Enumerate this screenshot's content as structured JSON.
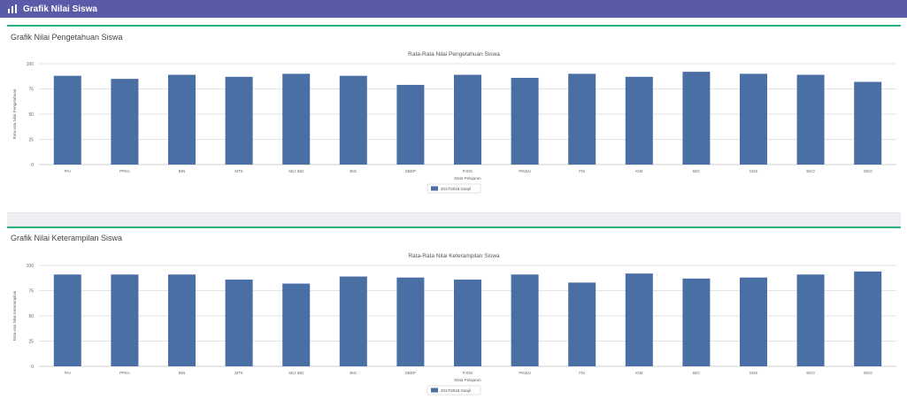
{
  "header": {
    "title": "Grafik Nilai Siswa",
    "icon": "chart-icon",
    "color": "#5a5ba8"
  },
  "colors": {
    "accent": "#2ab27b",
    "bar": "#4a6fa5"
  },
  "panels": [
    {
      "title": "Grafik Nilai Pengetahuan Siswa"
    },
    {
      "title": "Grafik Nilai Keterampilan Siswa"
    }
  ],
  "chart_data": [
    {
      "type": "bar",
      "title": "Rata-Rata Nilai Pengetahuan Siswa",
      "xlabel": "Mata Pelajaran",
      "ylabel": "Rata-rata Nilai Pengetahuan",
      "categories": [
        "PAI",
        "PPKn",
        "BIN",
        "MTK",
        "SEJ IND",
        "BIG",
        "SBDP",
        "PJOK",
        "PKWU",
        "FIS",
        "KIM",
        "BIO",
        "SOS",
        "EKO",
        "GEO"
      ],
      "yticks": [
        0,
        25,
        50,
        75,
        100
      ],
      "ylim": [
        0,
        100
      ],
      "grid": true,
      "legend": {
        "position": "bottom",
        "entries": [
          "2017/2018 Ganjil"
        ]
      },
      "series": [
        {
          "name": "2017/2018 Ganjil",
          "values": [
            88,
            85,
            89,
            87,
            90,
            88,
            79,
            89,
            86,
            90,
            87,
            92,
            90,
            89,
            82
          ]
        }
      ]
    },
    {
      "type": "bar",
      "title": "Rata-Rata Nilai Keterampilan Siswa",
      "xlabel": "Mata Pelajaran",
      "ylabel": "Rata-rata Nilai Keterampilan",
      "categories": [
        "PAI",
        "PPKn",
        "BIN",
        "MTK",
        "SEJ IND",
        "BIG",
        "SBDP",
        "PJOK",
        "PKWU",
        "FIS",
        "KIM",
        "BIO",
        "SOS",
        "EKO",
        "GEO"
      ],
      "yticks": [
        0,
        25,
        50,
        75,
        100
      ],
      "ylim": [
        0,
        100
      ],
      "grid": true,
      "legend": {
        "position": "bottom",
        "entries": [
          "2017/2018 Ganjil"
        ]
      },
      "series": [
        {
          "name": "2017/2018 Ganjil",
          "values": [
            91,
            91,
            91,
            86,
            82,
            89,
            88,
            86,
            91,
            83,
            92,
            87,
            88,
            91,
            94
          ]
        }
      ]
    }
  ]
}
